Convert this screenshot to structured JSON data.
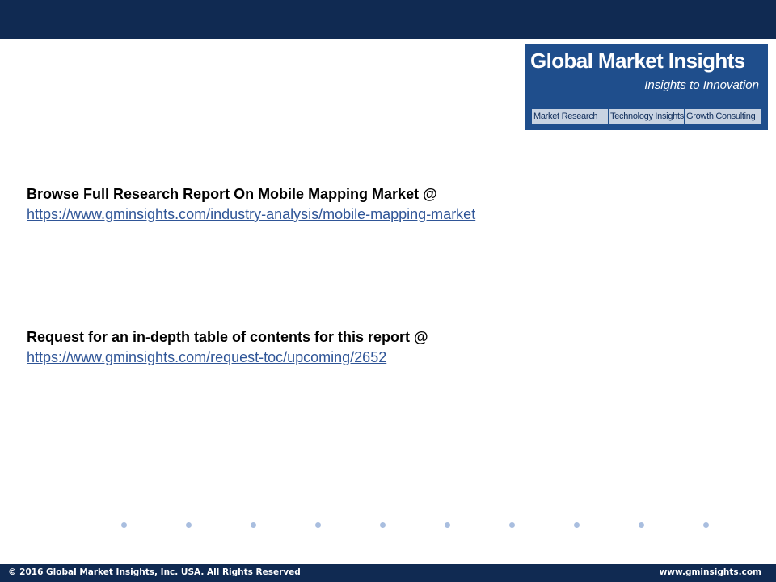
{
  "logo": {
    "title": "Global Market Insights",
    "tagline": "Insights to Innovation",
    "services": [
      "Market Research",
      "Technology Insights",
      "Growth Consulting"
    ]
  },
  "sections": [
    {
      "heading": "Browse Full Research Report On Mobile Mapping Market @",
      "link_text": "https://www.gminsights.com/industry-analysis/mobile-mapping-market"
    },
    {
      "heading": "Request for an in-depth table of contents for this report @",
      "link_text": "https://www.gminsights.com/request-toc/upcoming/2652"
    }
  ],
  "footer": {
    "copyright": "© 2016 Global Market Insights, Inc. USA.  All Rights Reserved",
    "website": "www.gminsights.com"
  },
  "colors": {
    "header_bar": "#102a52",
    "logo_background": "#1f4e8c",
    "link": "#2f5597",
    "dot": "#a9bedf"
  }
}
